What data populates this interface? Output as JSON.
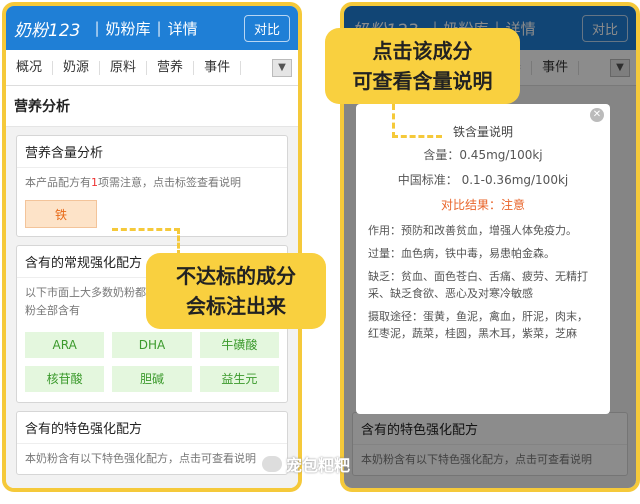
{
  "left": {
    "header": {
      "logo": "奶粉123",
      "crumb1": "奶粉库",
      "crumb2": "详情",
      "compare": "对比"
    },
    "tabs": [
      "概况",
      "奶源",
      "原料",
      "营养",
      "事件"
    ],
    "section_title": "营养分析",
    "card1": {
      "title": "营养含量分析",
      "text_a": "本产品配方有",
      "num": "1",
      "text_b": "项需注意，点击标签查看说明",
      "tag": "铁"
    },
    "card2": {
      "title": "含有的常规强化配方",
      "text": "以下市面上大多数奶粉都有的常规强化配方，本款奶粉全部含有",
      "items": [
        "ARA",
        "DHA",
        "牛磺酸",
        "核苷酸",
        "胆碱",
        "益生元"
      ]
    },
    "card3": {
      "title": "含有的特色强化配方",
      "text": "本奶粉含有以下特色强化配方，点击可查看说明"
    }
  },
  "right": {
    "header": {
      "logo": "奶粉123",
      "crumb1": "奶粉库",
      "crumb2": "详情",
      "compare": "对比"
    },
    "tabs": [
      "概况",
      "奶源",
      "原料",
      "营养",
      "事件"
    ],
    "modal": {
      "name": "铁含量说明",
      "amount": "含量：0.45mg/100kj",
      "standard": "中国标准：  0.1-0.36mg/100kj",
      "result": "对比结果：注意",
      "effect": "作用：预防和改善贫血，增强人体免疫力。",
      "excess": "过量：血色病，铁中毒，易患帕金森。",
      "deficiency": "缺乏：贫血、面色苍白、舌痛、疲劳、无精打采、缺乏食欲、恶心及对寒冷敏感",
      "sources": "摄取途径：蛋黄，鱼泥，禽血，肝泥，肉末，红枣泥，蔬菜，桂圆，黑木耳，紫菜，芝麻"
    },
    "card3": {
      "title": "含有的特色强化配方",
      "text": "本奶粉含有以下特色强化配方，点击可查看说明"
    }
  },
  "callouts": {
    "left": [
      "不达标的成分",
      "会标注出来"
    ],
    "right": [
      "点击该成分",
      "可查看含量说明"
    ]
  },
  "watermark": "宠包粑粑",
  "colors": {
    "header": "#1f7fd6",
    "callout": "#f9d03f",
    "border": "#f5c93a",
    "alert": "#e9642a"
  }
}
